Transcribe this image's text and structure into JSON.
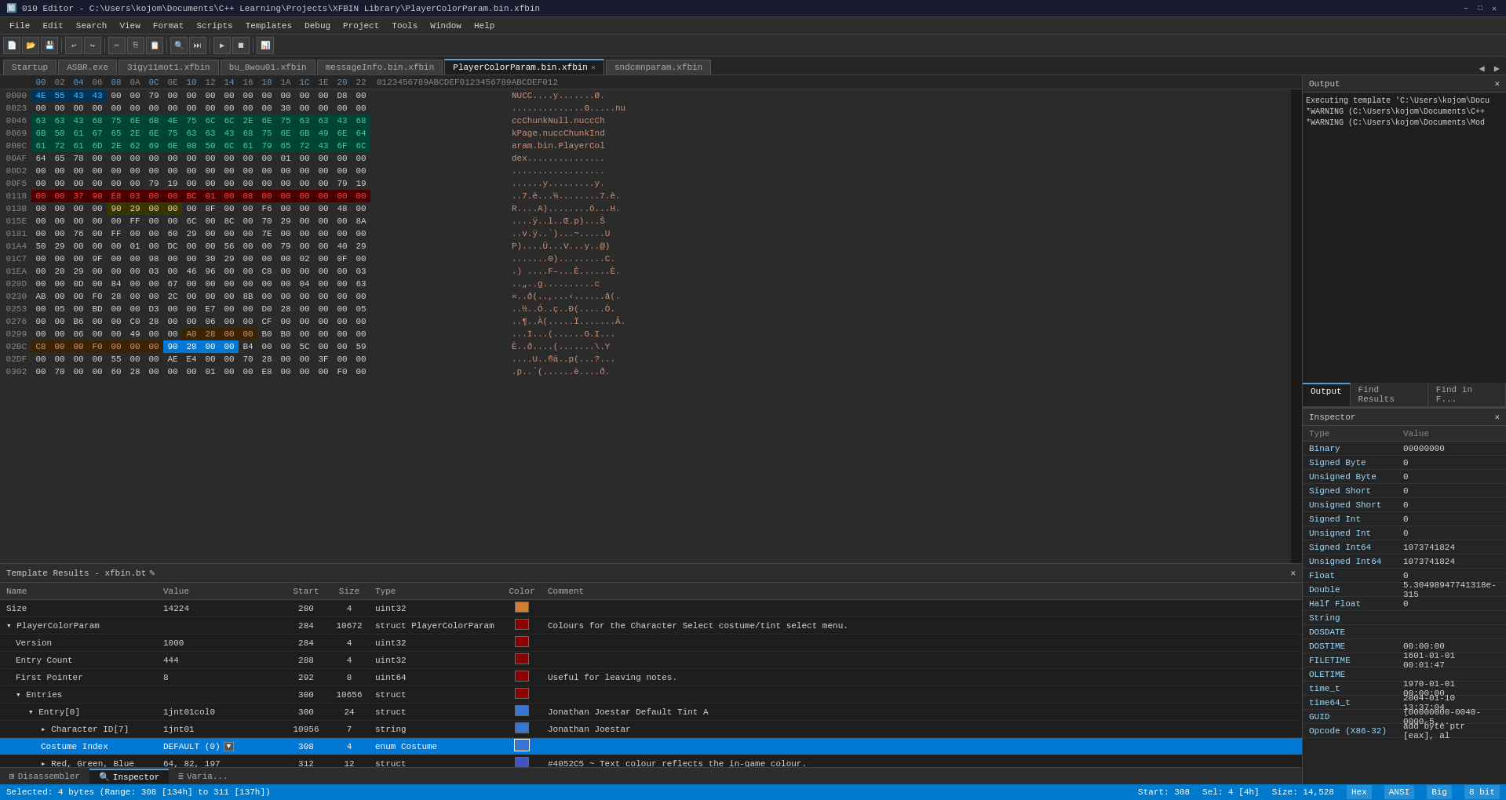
{
  "titlebar": {
    "title": "010 Editor - C:\\Users\\kojom\\Documents\\C++ Learning\\Projects\\XFBIN Library\\PlayerColorParam.bin.xfbin",
    "min": "–",
    "max": "□",
    "close": "✕"
  },
  "menubar": {
    "items": [
      "File",
      "Edit",
      "Search",
      "View",
      "Format",
      "Scripts",
      "Templates",
      "Debug",
      "Project",
      "Tools",
      "Window",
      "Help"
    ]
  },
  "tabs": {
    "items": [
      {
        "label": "Startup",
        "active": false,
        "closable": false
      },
      {
        "label": "ASBR.exe",
        "active": false,
        "closable": false
      },
      {
        "label": "3igy11mot1.xfbin",
        "active": false,
        "closable": false
      },
      {
        "label": "bu_8wou01.xfbin",
        "active": false,
        "closable": false
      },
      {
        "label": "messageInfo.bin.xfbin",
        "active": false,
        "closable": false
      },
      {
        "label": "PlayerColorParam.bin.xfbin",
        "active": true,
        "closable": true
      },
      {
        "label": "sndcmnparam.xfbin",
        "active": false,
        "closable": false
      }
    ]
  },
  "hex_header": {
    "cols": [
      "00",
      "02",
      "04",
      "06",
      "08",
      "0A",
      "0C",
      "0E",
      "10",
      "12",
      "14",
      "16",
      "18",
      "1A",
      "1C",
      "1E",
      "20",
      "22"
    ],
    "ascii_header": "0123456789ABCDEF0123456789ABCDEF012"
  },
  "output": {
    "title": "Output",
    "text_lines": [
      "Executing template 'C:\\Users\\kojom\\Docu",
      "*WARNING (C:\\Users\\kojom\\Documents\\C++",
      "*WARNING (C:\\Users\\kojom\\Documents\\Mod"
    ]
  },
  "output_tabs": [
    {
      "label": "Output",
      "active": true
    },
    {
      "label": "Find Results",
      "active": false
    },
    {
      "label": "Find in F...",
      "active": false
    }
  ],
  "inspector": {
    "title": "Inspector",
    "rows": [
      {
        "type": "Binary",
        "value": "00000000"
      },
      {
        "type": "Signed Byte",
        "value": "0"
      },
      {
        "type": "Unsigned Byte",
        "value": "0"
      },
      {
        "type": "Signed Short",
        "value": "0"
      },
      {
        "type": "Unsigned Short",
        "value": "0"
      },
      {
        "type": "Signed Int",
        "value": "0"
      },
      {
        "type": "Unsigned Int",
        "value": "0"
      },
      {
        "type": "Signed Int64",
        "value": "1073741824"
      },
      {
        "type": "Unsigned Int64",
        "value": "1073741824"
      },
      {
        "type": "Float",
        "value": "0"
      },
      {
        "type": "Double",
        "value": "5.30498947741318e-315"
      },
      {
        "type": "Half Float",
        "value": "0"
      },
      {
        "type": "String",
        "value": ""
      },
      {
        "type": "DOSDATE",
        "value": ""
      },
      {
        "type": "DOSTIME",
        "value": "00:00:00"
      },
      {
        "type": "FILETIME",
        "value": "1601-01-01 00:01:47"
      },
      {
        "type": "OLETIME",
        "value": ""
      },
      {
        "type": "time_t",
        "value": "1970-01-01 00:00:00"
      },
      {
        "type": "time64_t",
        "value": "2004-01-10 13:37:04"
      },
      {
        "type": "GUID",
        "value": "{00000000-0040-0000-5..."
      },
      {
        "type": "Opcode (X86-32)",
        "value": "add byte ptr [eax], al"
      }
    ]
  },
  "template_results": {
    "title": "Template Results - xfbin.bt",
    "col_headers": [
      "Name",
      "Value",
      "Start",
      "Size",
      "Type",
      "Color",
      "Comment"
    ],
    "rows": [
      {
        "indent": 0,
        "name": "Size",
        "value": "14224",
        "start": "280",
        "size": "4",
        "type": "uint32",
        "color": "#d08030",
        "comment": ""
      },
      {
        "indent": 0,
        "name": "PlayerColorParam",
        "value": "",
        "start": "284",
        "size": "10672",
        "type": "struct PlayerColorParam",
        "color": "#8b0000",
        "comment": "Colours for the Character Select costume/tint select menu."
      },
      {
        "indent": 1,
        "name": "Version",
        "value": "1000",
        "start": "284",
        "size": "4",
        "type": "uint32",
        "color": "#8b0000",
        "comment": ""
      },
      {
        "indent": 1,
        "name": "Entry Count",
        "value": "444",
        "start": "288",
        "size": "4",
        "type": "uint32",
        "color": "#8b0000",
        "comment": ""
      },
      {
        "indent": 1,
        "name": "First Pointer",
        "value": "8",
        "start": "292",
        "size": "8",
        "type": "uint64",
        "color": "#8b0000",
        "comment": "Useful for leaving notes."
      },
      {
        "indent": 1,
        "name": "▾ Entries",
        "value": "",
        "start": "300",
        "size": "10656",
        "type": "struct",
        "color": "#8b0000",
        "comment": ""
      },
      {
        "indent": 2,
        "name": "▾ Entry[0]",
        "value": "1jnt01col0",
        "start": "300",
        "size": "24",
        "type": "struct",
        "color": "#3875d7",
        "comment": "Jonathan Joestar Default Tint A"
      },
      {
        "indent": 3,
        "name": "▸ Character ID[7]",
        "value": "1jnt01",
        "start": "10956",
        "size": "7",
        "type": "string",
        "color": "#3875d7",
        "comment": "Jonathan Joestar"
      },
      {
        "indent": 3,
        "name": "Costume Index",
        "value": "DEFAULT (0)",
        "start": "308",
        "size": "4",
        "type": "enum Costume",
        "color": "#3875d7",
        "comment": "",
        "selected": true
      },
      {
        "indent": 3,
        "name": "▸ Red, Green, Blue",
        "value": "64, 82, 197",
        "start": "312",
        "size": "12",
        "type": "struct",
        "color": "#4052c5",
        "comment": "#4052C5 ~ Text colour reflects the in-game colour."
      }
    ]
  },
  "statusbar": {
    "selected": "Selected: 4 bytes (Range: 308 [134h] to 311 [137h])",
    "start": "Start: 308",
    "sel": "Sel: 4 [4h]",
    "size": "Size: 14,528",
    "hex": "Hex",
    "ansi": "ANSI",
    "big": "Big",
    "bits": "8 bit"
  },
  "bottom_tabs": [
    {
      "label": "⊞ Disassembler",
      "active": false
    },
    {
      "label": "🔍 Inspector",
      "active": true
    },
    {
      "label": "≣ Varia...",
      "active": false
    }
  ]
}
